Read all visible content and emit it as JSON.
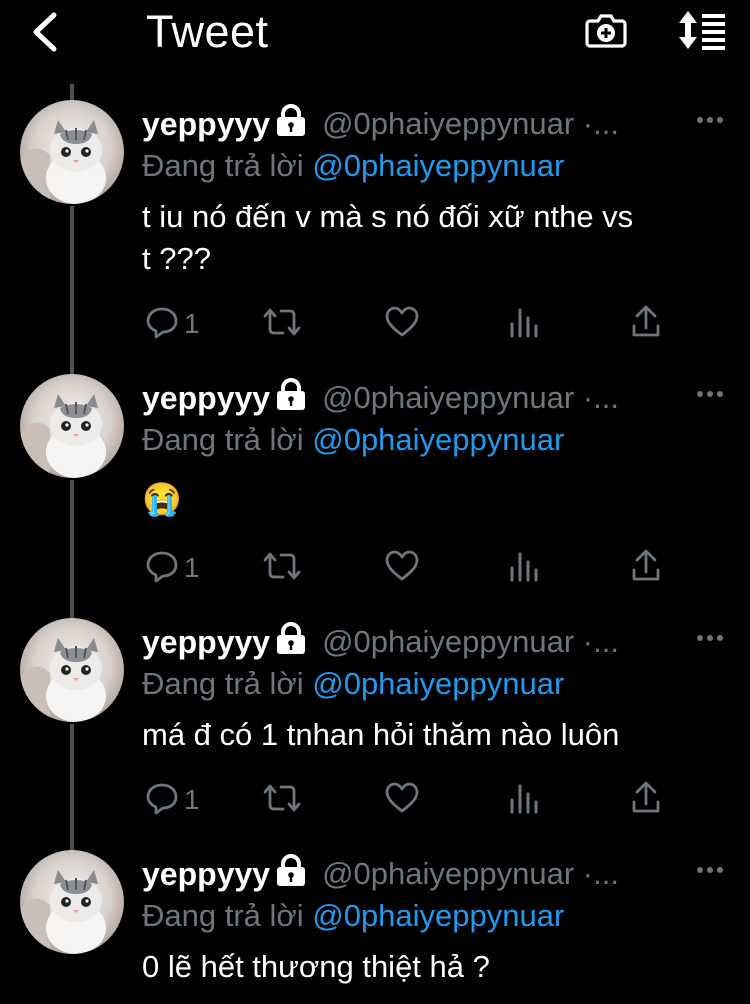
{
  "header": {
    "title": "Tweet",
    "back_icon": "chevron-left-icon",
    "camera_icon": "camera-add-icon",
    "sort_icon": "sort-list-icon"
  },
  "colors": {
    "background": "#000000",
    "text": "#ffffff",
    "muted": "#6e767d",
    "accent": "#1d9bf0",
    "thread_line": "#4a4f54"
  },
  "tweets": [
    {
      "name": "yeppyyy",
      "handle": "@0phaiyeppynuar ·...",
      "reply_prefix": "Đang trả lời ",
      "reply_to": "@0phaiyeppynuar",
      "text_line1": "t iu nó đến v mà s nó đối xữ nthe vs",
      "text_line2": "t ???",
      "reply_count": "1"
    },
    {
      "name": "yeppyyy",
      "handle": "@0phaiyeppynuar ·...",
      "reply_prefix": "Đang trả lời ",
      "reply_to": "@0phaiyeppynuar",
      "text": "😭",
      "reply_count": "1"
    },
    {
      "name": "yeppyyy",
      "handle": "@0phaiyeppynuar ·...",
      "reply_prefix": "Đang trả lời ",
      "reply_to": "@0phaiyeppynuar",
      "text": "má đ có 1 tnhan hỏi thăm nào luôn",
      "reply_count": "1"
    },
    {
      "name": "yeppyyy",
      "handle": "@0phaiyeppynuar ·...",
      "reply_prefix": "Đang trả lời ",
      "reply_to": "@0phaiyeppynuar",
      "text": "0 lẽ hết thương thiệt hả ?"
    }
  ]
}
